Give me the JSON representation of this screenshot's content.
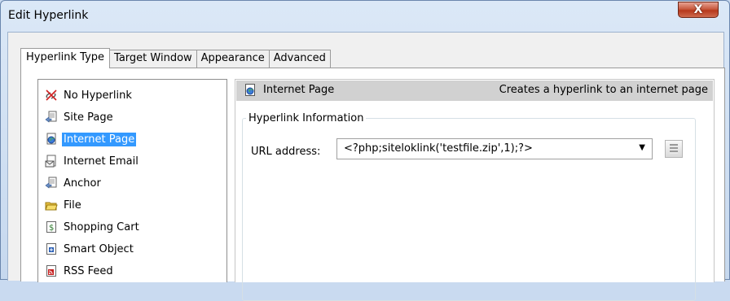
{
  "window": {
    "title": "Edit Hyperlink",
    "close_label": "X"
  },
  "tabs": [
    {
      "label": "Hyperlink Type",
      "active": true
    },
    {
      "label": "Target Window",
      "active": false
    },
    {
      "label": "Appearance",
      "active": false
    },
    {
      "label": "Advanced",
      "active": false
    }
  ],
  "types": [
    {
      "label": "No Hyperlink",
      "icon": "no-link-icon"
    },
    {
      "label": "Site Page",
      "icon": "site-page-icon"
    },
    {
      "label": "Internet Page",
      "icon": "internet-page-icon",
      "selected": true
    },
    {
      "label": "Internet Email",
      "icon": "email-icon"
    },
    {
      "label": "Anchor",
      "icon": "anchor-icon"
    },
    {
      "label": "File",
      "icon": "file-icon"
    },
    {
      "label": "Shopping Cart",
      "icon": "shopping-cart-icon"
    },
    {
      "label": "Smart Object",
      "icon": "smart-object-icon"
    },
    {
      "label": "RSS Feed",
      "icon": "rss-feed-icon"
    }
  ],
  "detail": {
    "title": "Internet Page",
    "description": "Creates a hyperlink to an internet page",
    "group_label": "Hyperlink Information",
    "url_label": "URL address:",
    "url_value": "<?php;siteloklink('testfile.zip',1);?>"
  }
}
